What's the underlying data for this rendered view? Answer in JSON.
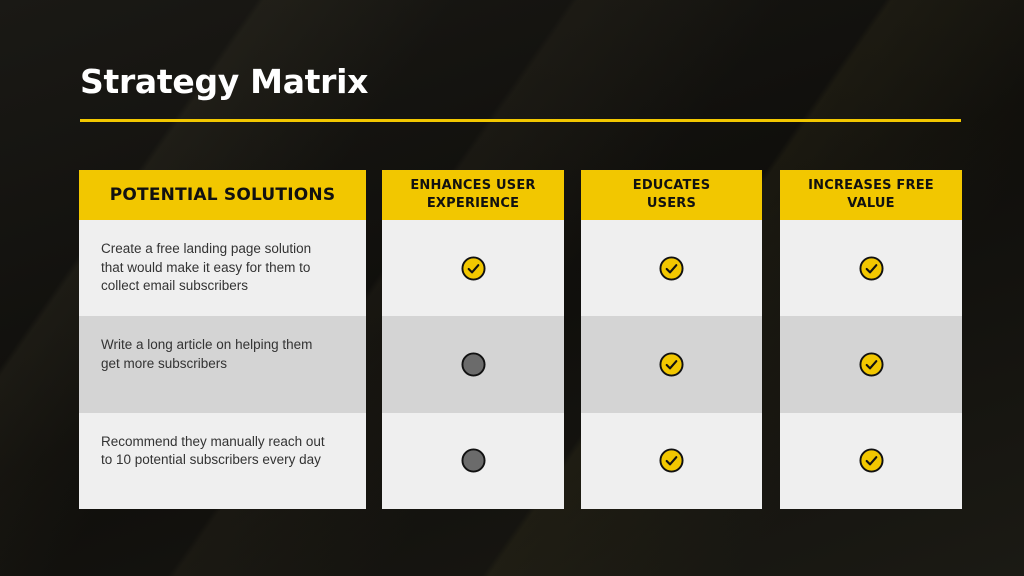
{
  "title": "Strategy Matrix",
  "colors": {
    "accent": "#f2c700",
    "background": "#141310",
    "row_light": "#efefef",
    "row_dark": "#d4d4d4",
    "no_marker": "#6b6b6b"
  },
  "columns": [
    {
      "label": "POTENTIAL SOLUTIONS"
    },
    {
      "label": "ENHANCES USER\nEXPERIENCE"
    },
    {
      "label": "EDUCATES\nUSERS"
    },
    {
      "label": "INCREASES FREE\nVALUE"
    }
  ],
  "rows": [
    {
      "solution": "Create a free landing page solution that would make it easy for them to collect email subscribers",
      "marks": [
        "check-icon",
        "check-icon",
        "check-icon"
      ]
    },
    {
      "solution": "Write a long article on helping them get more subscribers",
      "marks": [
        "empty-circle-icon",
        "check-icon",
        "check-icon"
      ]
    },
    {
      "solution": "Recommend they manually reach out to 10 potential subscribers every day",
      "marks": [
        "empty-circle-icon",
        "check-icon",
        "check-icon"
      ]
    }
  ]
}
